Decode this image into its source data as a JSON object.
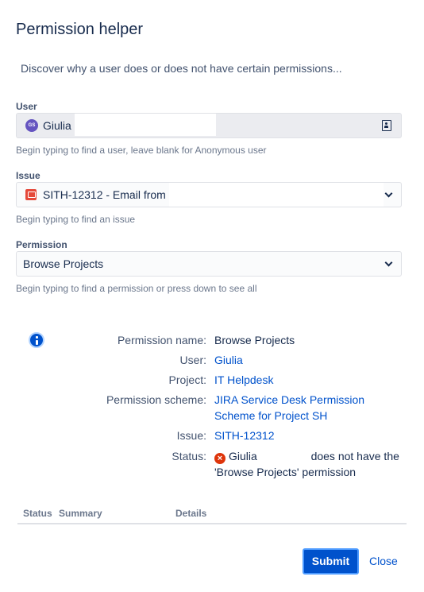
{
  "dialog": {
    "title": "Permission helper",
    "description": "Discover why a user does or does not have certain permissions..."
  },
  "user_field": {
    "label": "User",
    "avatar_initials": "GS",
    "value": "Giulia",
    "hint": "Begin typing to find a user, leave blank for Anonymous user"
  },
  "issue_field": {
    "label": "Issue",
    "value": "SITH-12312 - Email from",
    "hint": "Begin typing to find an issue"
  },
  "permission_field": {
    "label": "Permission",
    "value": "Browse Projects",
    "hint": "Begin typing to find a permission or press down to see all"
  },
  "result": {
    "permission_name_label": "Permission name:",
    "permission_name": "Browse Projects",
    "user_label": "User:",
    "user": "Giulia",
    "project_label": "Project:",
    "project": "IT Helpdesk",
    "scheme_label": "Permission scheme:",
    "scheme_line1": "JIRA Service Desk Permission",
    "scheme_line2": "Scheme for Project SH",
    "issue_label": "Issue:",
    "issue": "SITH-12312",
    "status_label": "Status:",
    "status_user": "Giulia",
    "status_text_1": "does not have the",
    "status_text_2": "'Browse Projects' permission"
  },
  "table": {
    "columns": [
      "Status",
      "Summary",
      "Details"
    ]
  },
  "actions": {
    "submit": "Submit",
    "close": "Close"
  }
}
